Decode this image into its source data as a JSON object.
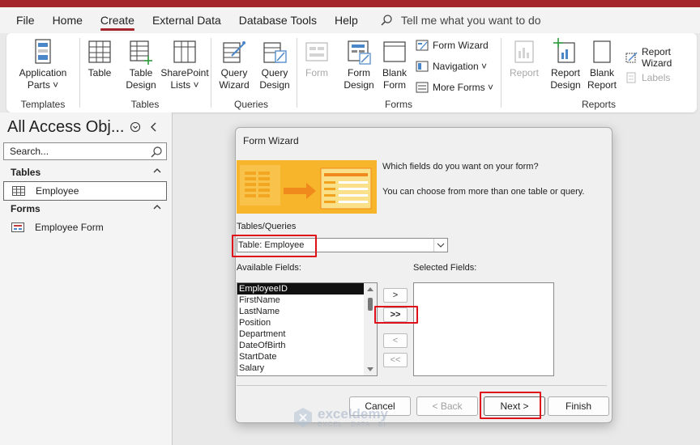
{
  "menubar": {
    "items": [
      "File",
      "Home",
      "Create",
      "External Data",
      "Database Tools",
      "Help"
    ],
    "active_index": 2,
    "tell_me": "Tell me what you want to do"
  },
  "ribbon": {
    "groups": {
      "templates": {
        "label": "Templates",
        "application_parts": "Application",
        "application_parts_2": "Parts ˅"
      },
      "tables": {
        "label": "Tables",
        "table": "Table",
        "table_design_1": "Table",
        "table_design_2": "Design",
        "sharepoint_1": "SharePoint",
        "sharepoint_2": "Lists ˅"
      },
      "queries": {
        "label": "Queries",
        "query_wizard_1": "Query",
        "query_wizard_2": "Wizard",
        "query_design_1": "Query",
        "query_design_2": "Design"
      },
      "forms": {
        "label": "Forms",
        "form": "Form",
        "form_design_1": "Form",
        "form_design_2": "Design",
        "blank_form_1": "Blank",
        "blank_form_2": "Form",
        "form_wizard": "Form Wizard",
        "navigation": "Navigation ˅",
        "more_forms": "More Forms ˅"
      },
      "reports": {
        "label": "Reports",
        "report": "Report",
        "report_design_1": "Report",
        "report_design_2": "Design",
        "blank_report_1": "Blank",
        "blank_report_2": "Report",
        "report_wizard": "Report Wizard",
        "labels": "Labels"
      }
    }
  },
  "nav_pane": {
    "title": "All Access Obj...",
    "search_placeholder": "Search...",
    "sections": [
      {
        "name": "Tables",
        "items": [
          "Employee"
        ]
      },
      {
        "name": "Forms",
        "items": [
          "Employee Form"
        ]
      }
    ]
  },
  "dialog": {
    "title": "Form Wizard",
    "question": "Which fields do you want on your form?",
    "hint": "You can choose from more than one table or query.",
    "tables_queries_label": "Tables/Queries",
    "combo_value": "Table: Employee",
    "available_label": "Available Fields:",
    "selected_label": "Selected Fields:",
    "available_fields": [
      "EmployeeID",
      "FirstName",
      "LastName",
      "Position",
      "Department",
      "DateOfBirth",
      "StartDate",
      "Salary"
    ],
    "selected_fields": [],
    "move_one": ">",
    "move_all": ">>",
    "remove_one": "<",
    "remove_all": "<<",
    "buttons": {
      "cancel": "Cancel",
      "back": "< Back",
      "next": "Next >",
      "finish": "Finish"
    }
  },
  "watermark": {
    "name": "exceldemy",
    "tagline": "EXCEL · DATA · BI"
  },
  "colors": {
    "accent": "#a4262c",
    "highlight": "#e0101a",
    "banner": "#f6b52a"
  }
}
